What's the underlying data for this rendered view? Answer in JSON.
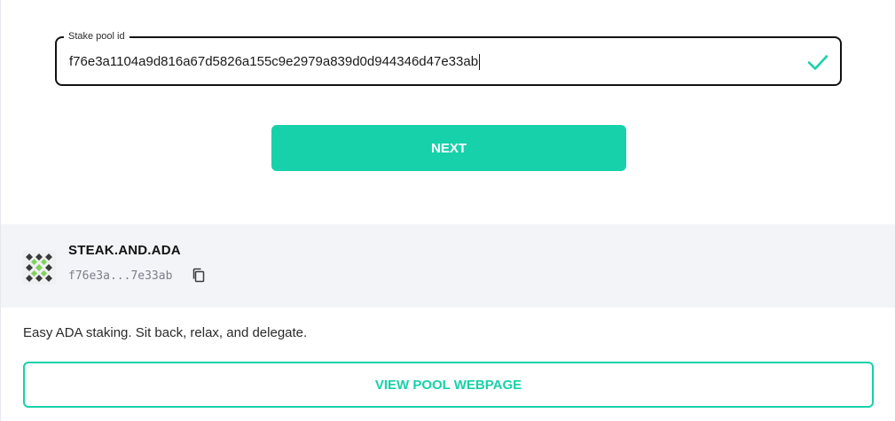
{
  "stake_field": {
    "label": "Stake pool id",
    "value": "f76e3a1104a9d816a67d5826a155c9e2979a839d0d944346d47e33ab",
    "valid_icon": "check-icon"
  },
  "next_button": {
    "label": "NEXT"
  },
  "pool": {
    "name": "STEAK.AND.ADA",
    "id_short": "f76e3a...7e33ab",
    "logo_icon": "pool-logo-icon",
    "copy_icon": "copy-icon",
    "description": "Easy ADA staking. Sit back, relax, and delegate.",
    "view_button_label": "VIEW POOL WEBPAGE"
  },
  "colors": {
    "accent": "#17d1aa",
    "pool_header_bg": "#f3f4f8",
    "field_border": "#121212",
    "muted_text": "#7b7f8a"
  }
}
